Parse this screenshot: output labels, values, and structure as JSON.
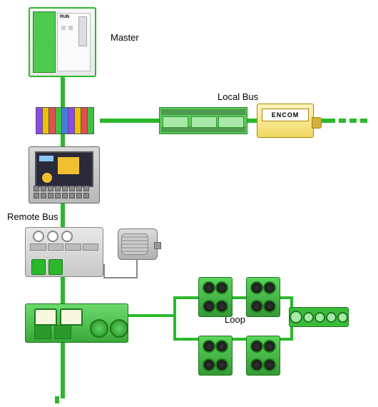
{
  "labels": {
    "master": "Master",
    "local_bus": "Local Bus",
    "remote_bus": "Remote Bus",
    "loop": "Loop",
    "encom": "ENCOM"
  },
  "diagram": {
    "type": "topology",
    "bus_color": "#2bb82b",
    "nodes": [
      {
        "id": "master",
        "kind": "plc-controller",
        "label": "Master"
      },
      {
        "id": "module-stack",
        "kind": "io-modules"
      },
      {
        "id": "localbus-block",
        "kind": "bus-coupler",
        "label": "Local Bus"
      },
      {
        "id": "encom",
        "kind": "encoder",
        "brand": "ENCOM"
      },
      {
        "id": "hmi",
        "kind": "hmi-panel"
      },
      {
        "id": "iobox",
        "kind": "io-terminal"
      },
      {
        "id": "motor",
        "kind": "motor"
      },
      {
        "id": "power-box",
        "kind": "power-supply"
      },
      {
        "id": "conn-bar",
        "kind": "connector-strip",
        "ports": 5
      },
      {
        "id": "loop-node-1",
        "kind": "field-connector"
      },
      {
        "id": "loop-node-2",
        "kind": "field-connector"
      },
      {
        "id": "loop-node-3",
        "kind": "field-connector"
      },
      {
        "id": "loop-node-4",
        "kind": "field-connector"
      }
    ],
    "edges": [
      {
        "from": "master",
        "to": "module-stack",
        "bus": "remote"
      },
      {
        "from": "module-stack",
        "to": "localbus-block",
        "bus": "local"
      },
      {
        "from": "localbus-block",
        "to": "encom",
        "bus": "local"
      },
      {
        "from": "module-stack",
        "to": "hmi",
        "bus": "remote"
      },
      {
        "from": "hmi",
        "to": "iobox",
        "bus": "remote"
      },
      {
        "from": "iobox",
        "to": "motor",
        "bus": "signal"
      },
      {
        "from": "iobox",
        "to": "power-box",
        "bus": "remote"
      },
      {
        "from": "power-box",
        "to": "loop-node-1",
        "bus": "loop"
      },
      {
        "from": "loop-node-1",
        "to": "loop-node-2",
        "bus": "loop"
      },
      {
        "from": "loop-node-2",
        "to": "conn-bar",
        "bus": "loop"
      },
      {
        "from": "conn-bar",
        "to": "loop-node-4",
        "bus": "loop"
      },
      {
        "from": "loop-node-4",
        "to": "loop-node-3",
        "bus": "loop"
      },
      {
        "from": "loop-node-3",
        "to": "power-box",
        "bus": "loop"
      }
    ]
  }
}
